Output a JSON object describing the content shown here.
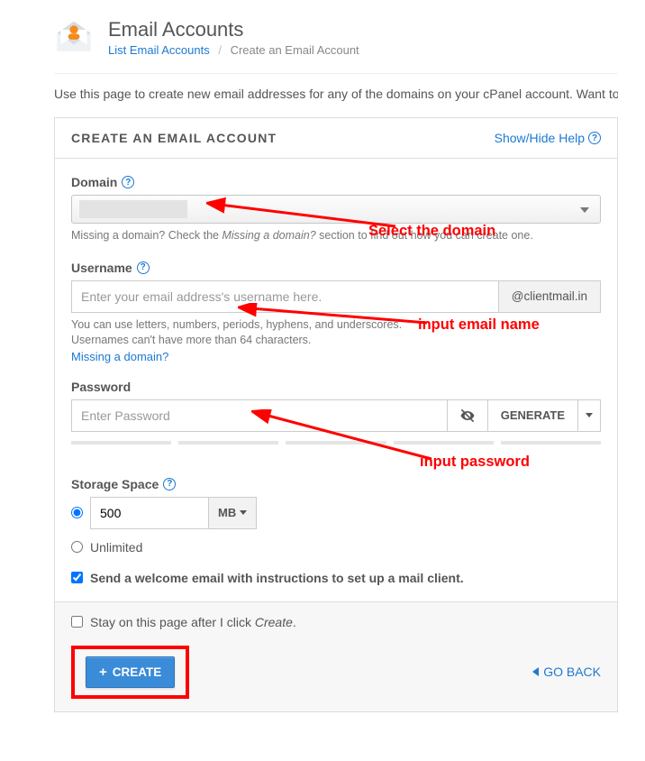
{
  "header": {
    "title": "Email Accounts",
    "breadcrumb_list_label": "List Email Accounts",
    "breadcrumb_current": "Create an Email Account"
  },
  "intro_text": "Use this page to create new email addresses for any of the domains on your cPanel account. Want to",
  "panel": {
    "title": "CREATE AN EMAIL ACCOUNT",
    "help_toggle": "Show/Hide Help"
  },
  "domain": {
    "label": "Domain",
    "hint_prefix": "Missing a domain? Check the ",
    "hint_italic": "Missing a domain?",
    "hint_suffix": " section to find out how you can create one.",
    "annotation": "Select the domain"
  },
  "username": {
    "label": "Username",
    "placeholder": "Enter your email address's username here.",
    "addon": "@clientmail.in",
    "hint_line1": "You can use letters, numbers, periods, hyphens, and underscores.",
    "hint_line2": "Usernames can't have more than 64 characters.",
    "missing_link": "Missing a domain?",
    "annotation": "input email name"
  },
  "password": {
    "label": "Password",
    "placeholder": "Enter Password",
    "generate_label": "GENERATE",
    "annotation": "input password"
  },
  "storage": {
    "label": "Storage Space",
    "value": "500",
    "unit": "MB",
    "unlimited_label": "Unlimited"
  },
  "welcome_checkbox": "Send a welcome email with instructions to set up a mail client.",
  "stay_checkbox_prefix": "Stay on this page after I click ",
  "stay_checkbox_italic": "Create",
  "footer": {
    "create_label": "CREATE",
    "go_back_label": "GO BACK"
  }
}
